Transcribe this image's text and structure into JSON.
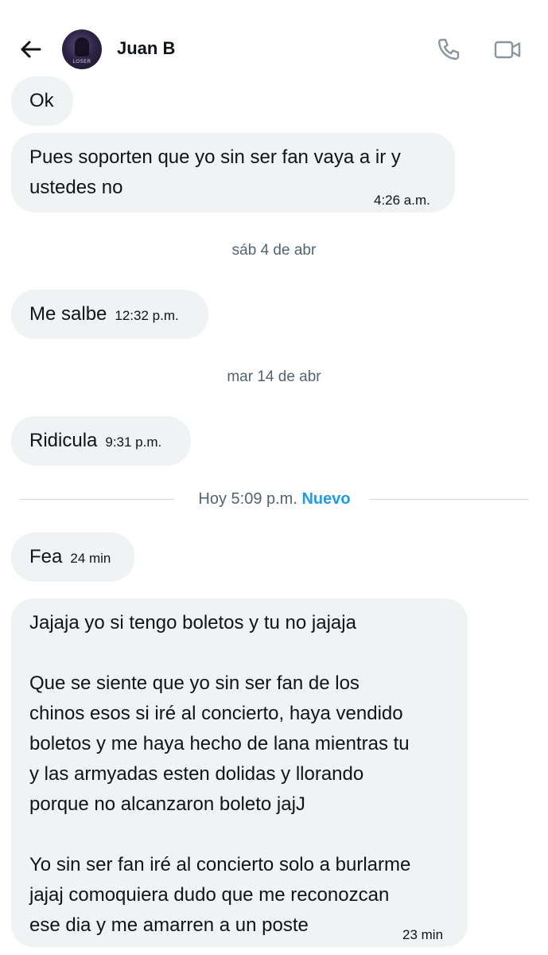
{
  "header": {
    "contact_name": "Juan B",
    "avatar_text": "LOSER",
    "icons": {
      "back": "arrow-left-icon",
      "call": "phone-icon",
      "video": "video-camera-icon"
    }
  },
  "messages": [
    {
      "text": "Ok",
      "time": ""
    },
    {
      "text": "Pues soporten que yo sin ser fan vaya a ir y\nustedes no",
      "time": "4:26 a.m."
    },
    {
      "text": "Me salbe",
      "time": "12:32 p.m."
    },
    {
      "text": "Ridicula",
      "time": "9:31 p.m."
    },
    {
      "text": "Fea",
      "time": "24 min"
    },
    {
      "text": "Jajaja yo si tengo boletos y tu no jajaja\n\nQue se siente que yo sin ser fan de los\nchinos esos si iré al concierto, haya vendido\nboletos y me haya hecho de lana mientras tu\ny las armyadas esten dolidas y llorando\nporque no alcanzaron boleto jajJ\n\nYo sin ser fan iré al concierto solo a burlarme\njajaj comoquiera dudo que me reconozcan\nese dia y me amarren a un poste",
      "time": "23 min"
    }
  ],
  "separators": {
    "date1": "sáb 4 de abr",
    "date2": "mar 14 de abr",
    "today_label": "Hoy 5:09 p.m.",
    "new_label": "Nuevo"
  },
  "colors": {
    "bubble": "#eff3f4",
    "text": "#0f1419",
    "secondary": "#536471",
    "accent": "#1d9bf0",
    "icon": "#8a959e"
  }
}
